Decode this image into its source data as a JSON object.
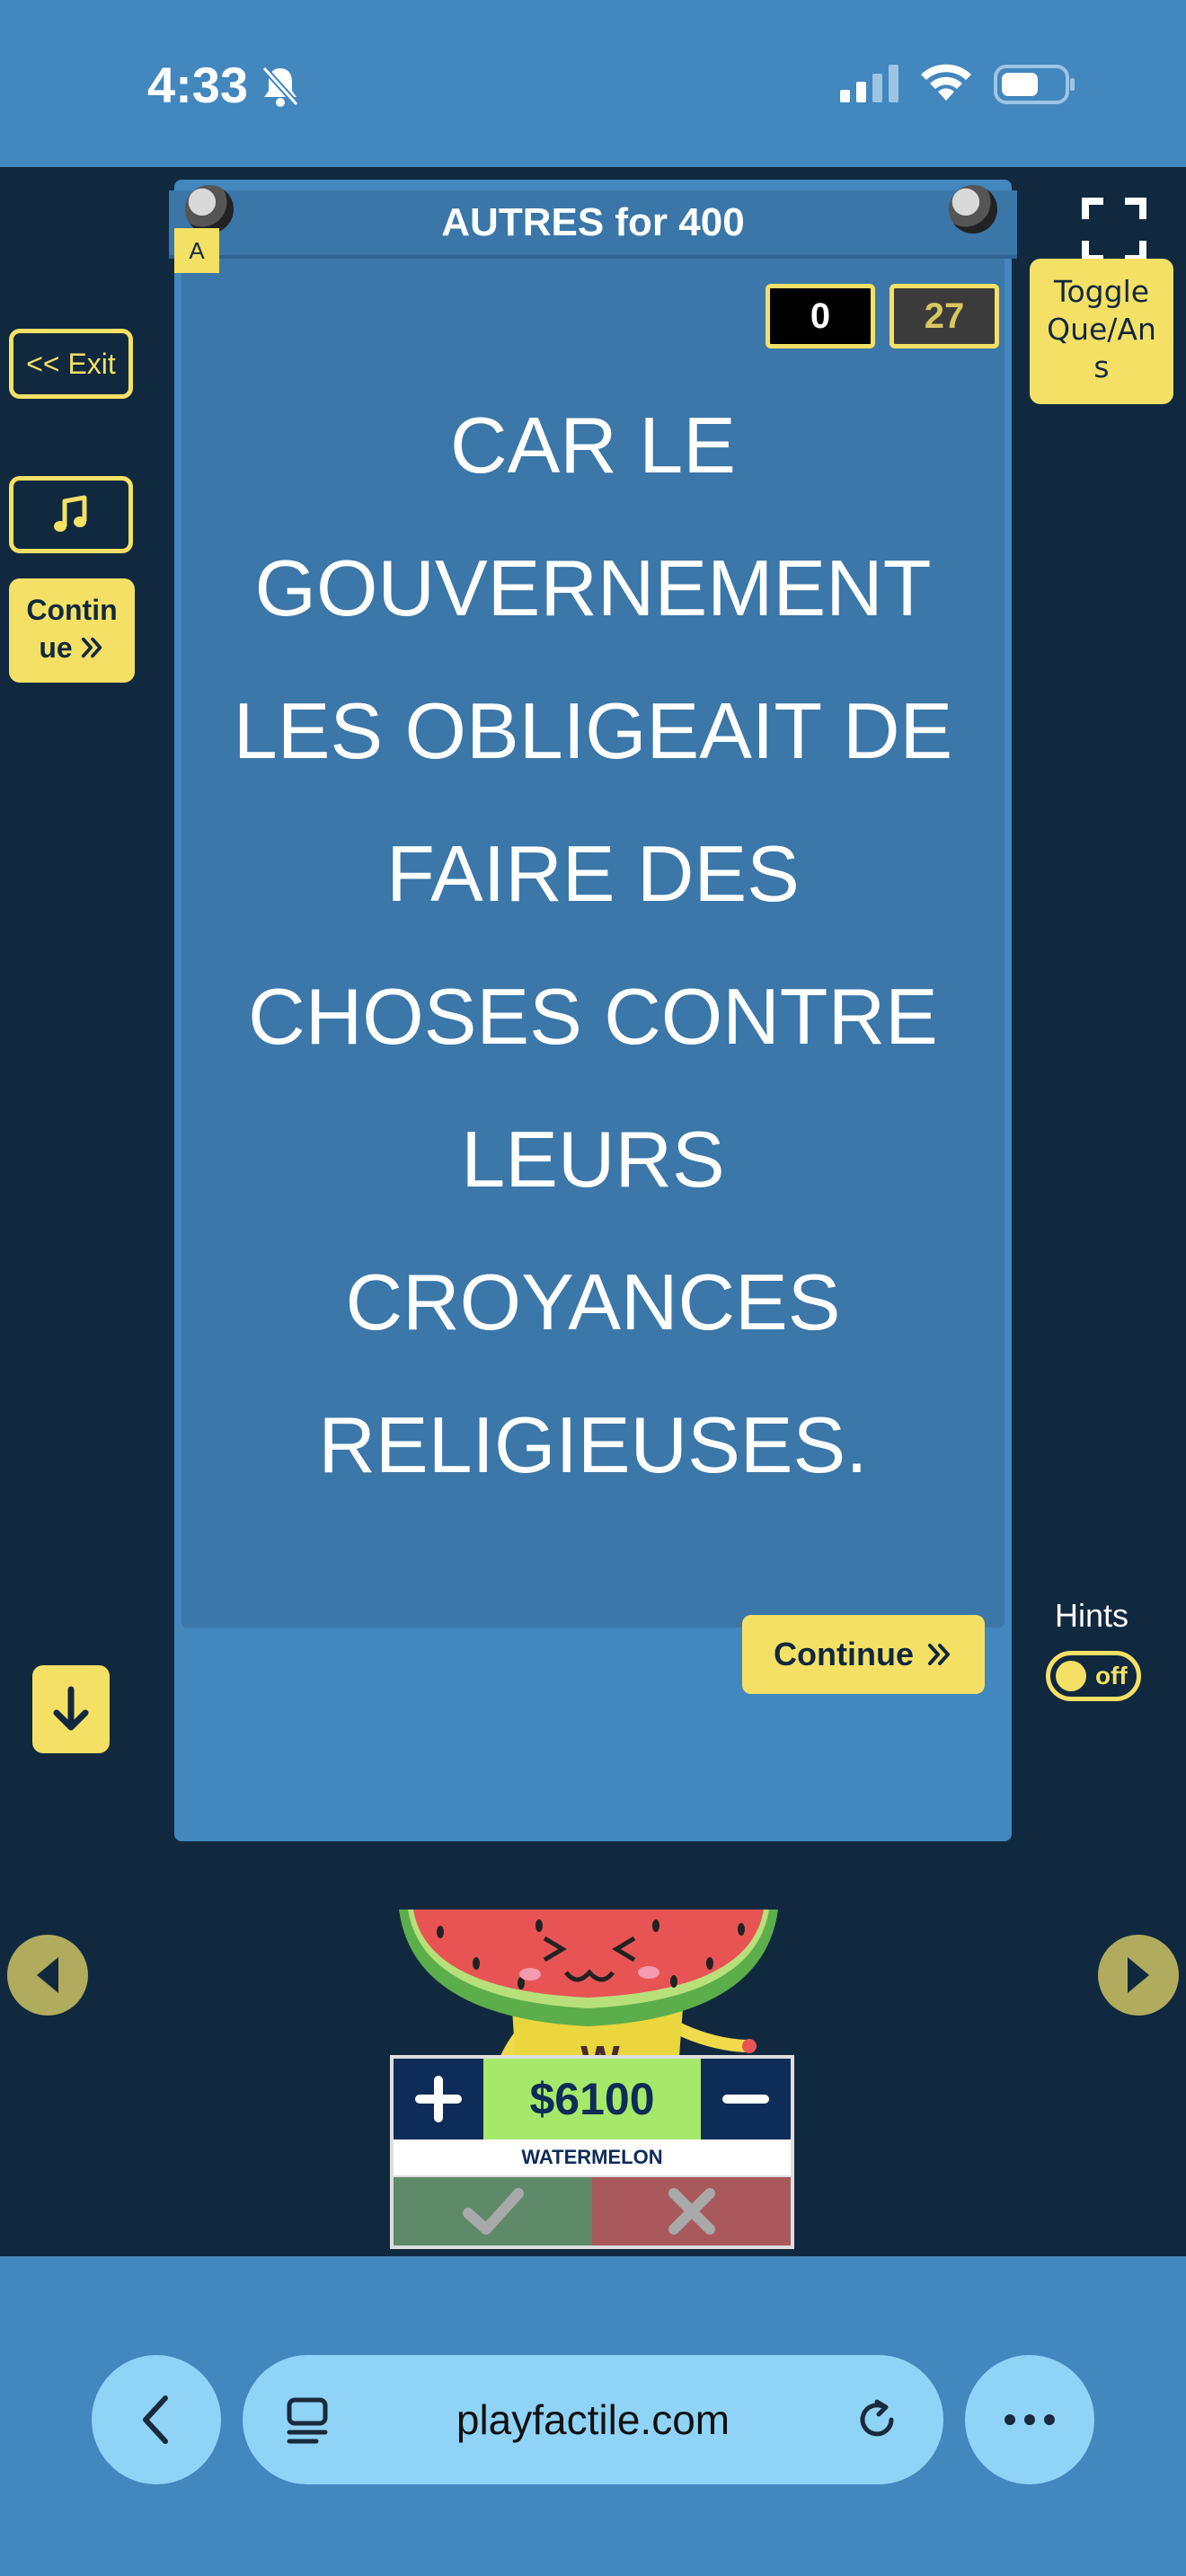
{
  "status_bar": {
    "time": "4:33",
    "icons": [
      "bell-slash-icon",
      "cellular-signal-icon",
      "wifi-icon",
      "battery-icon"
    ]
  },
  "card": {
    "header": "AUTRES for 400",
    "badge": "A",
    "score_left": "0",
    "score_right": "27",
    "question_lines": [
      "CAR LE",
      "GOUVERNEMENT",
      "LES OBLIGEAIT DE",
      "FAIRE DES",
      "CHOSES CONTRE",
      "LEURS",
      "CROYANCES",
      "RELIGIEUSES."
    ],
    "continue_label": "Continue"
  },
  "left_controls": {
    "exit_label": "<< Exit",
    "continue_label_line1": "Contin",
    "continue_label_line2": "ue"
  },
  "right_controls": {
    "toggle_line1": "Toggle",
    "toggle_line2": "Que/An",
    "toggle_line3": "s",
    "hints_label": "Hints",
    "hints_state": "off"
  },
  "team": {
    "score": "$6100",
    "name": "WATERMELON",
    "mascot_letter": "W"
  },
  "browser": {
    "url": "playfactile.com"
  },
  "colors": {
    "accent_yellow": "#f5e066",
    "card_blue": "#3b77a8",
    "background_navy": "#11293f",
    "browser_blue": "#4287be"
  }
}
